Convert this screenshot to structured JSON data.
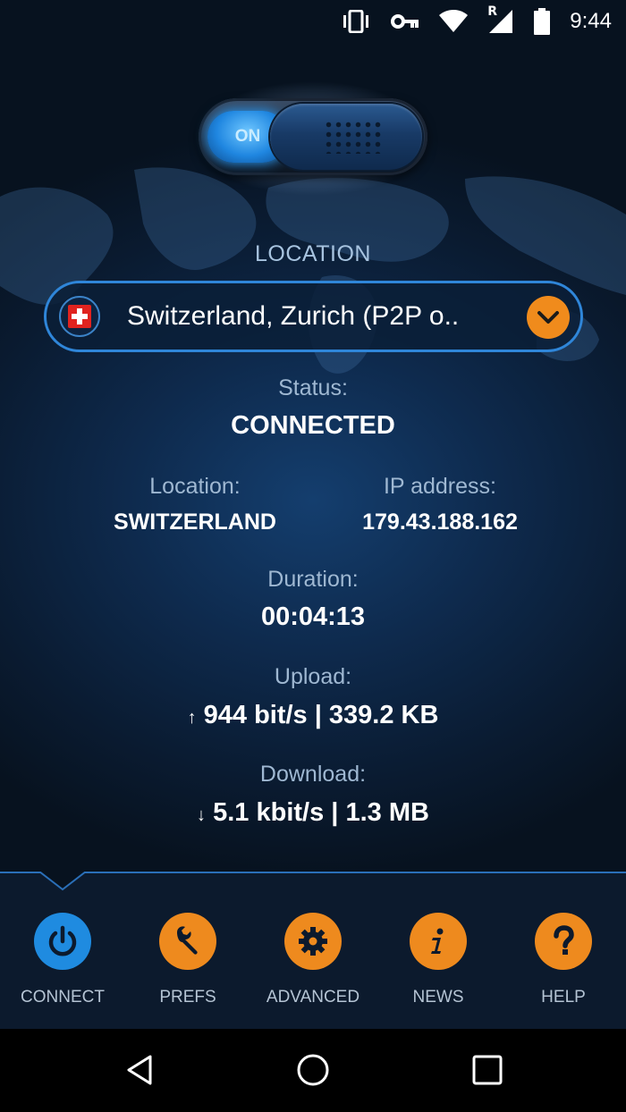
{
  "status_bar": {
    "time": "9:44",
    "icons": [
      "vibrate-icon",
      "vpn-key-icon",
      "wifi-icon",
      "signal-roaming-icon",
      "battery-icon"
    ],
    "roaming_letter": "R"
  },
  "toggle": {
    "label": "ON",
    "state": "on"
  },
  "location_select": {
    "heading": "LOCATION",
    "value": "Switzerland, Zurich (P2P o..",
    "flag": "switzerland-flag-icon"
  },
  "status": {
    "label": "Status:",
    "value": "CONNECTED"
  },
  "location": {
    "label": "Location:",
    "value": "SWITZERLAND"
  },
  "ip": {
    "label": "IP address:",
    "value": "179.43.188.162"
  },
  "duration": {
    "label": "Duration:",
    "value": "00:04:13"
  },
  "upload": {
    "label": "Upload:",
    "arrow": "↑",
    "value": "944 bit/s | 339.2 KB"
  },
  "download": {
    "label": "Download:",
    "arrow": "↓",
    "value": "5.1 kbit/s | 1.3 MB"
  },
  "nav": [
    {
      "label": "CONNECT",
      "icon": "power-icon",
      "active": true
    },
    {
      "label": "PREFS",
      "icon": "wrench-icon",
      "active": false
    },
    {
      "label": "ADVANCED",
      "icon": "gear-icon",
      "active": false
    },
    {
      "label": "NEWS",
      "icon": "info-icon",
      "active": false
    },
    {
      "label": "HELP",
      "icon": "question-icon",
      "active": false
    }
  ],
  "colors": {
    "accent_blue": "#1f8be0",
    "accent_orange": "#f08b1c",
    "background": "#0b1a2c"
  }
}
